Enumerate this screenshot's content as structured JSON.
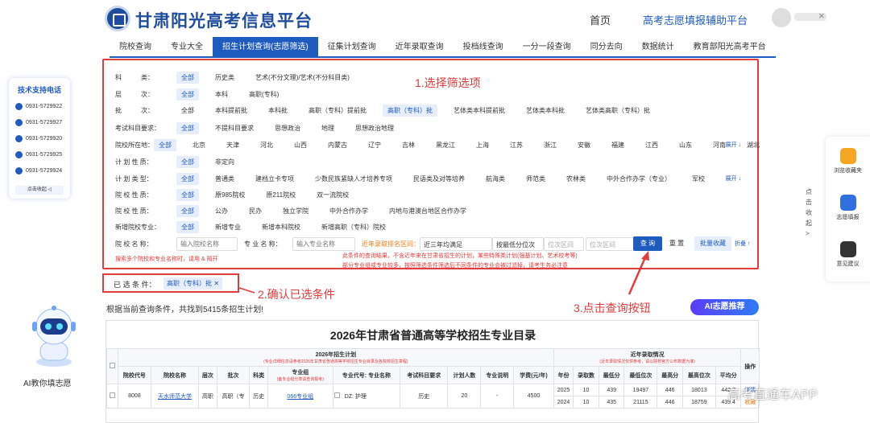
{
  "header": {
    "site_title": "甘肃阳光高考信息平台",
    "nav_home": "首页",
    "nav_fill": "高考志愿填报辅助平台",
    "user_close": "×"
  },
  "tabs": [
    {
      "label": "院校查询"
    },
    {
      "label": "专业大全"
    },
    {
      "label": "招生计划查询(志愿筛选)",
      "active": true
    },
    {
      "label": "征集计划查询"
    },
    {
      "label": "近年录取查询"
    },
    {
      "label": "投档线查询"
    },
    {
      "label": "一分一段查询"
    },
    {
      "label": "同分去向"
    },
    {
      "label": "数据统计"
    },
    {
      "label": "教育部阳光高考平台"
    }
  ],
  "filters": [
    {
      "label": "科　　　类：",
      "options": [
        "全部",
        "历史类",
        "艺术(不分文理)/艺术(不分科目类)"
      ],
      "selected": 0
    },
    {
      "label": "层　　　次：",
      "options": [
        "全部",
        "本科",
        "高职(专科)"
      ],
      "selected": 0
    },
    {
      "label": "批　　　次：",
      "options": [
        "全部",
        "本科提前批",
        "本科批",
        "高职（专科）提前批",
        "高职（专科）批",
        "艺体类本科提前批",
        "艺体类本科批",
        "艺体类高职（专科）批"
      ],
      "selected": 4
    },
    {
      "label": "考试科目要求：",
      "options": [
        "全部",
        "不提科目要求",
        "思想政治",
        "地理",
        "思想政治地理"
      ],
      "selected": 0
    },
    {
      "label": "院校所在地：",
      "options": [
        "全部",
        "北京",
        "天津",
        "河北",
        "山西",
        "内蒙古",
        "辽宁",
        "吉林",
        "黑龙江",
        "上海",
        "江苏",
        "浙江",
        "安徽",
        "福建",
        "江西",
        "山东",
        "河南",
        "湖北"
      ],
      "selected": 0,
      "expand": "展开 ↓"
    },
    {
      "label": "计 划 性 质：",
      "options": [
        "全部",
        "非定向"
      ],
      "selected": 0
    },
    {
      "label": "计 划 类 型：",
      "options": [
        "全部",
        "普通类",
        "建档立卡专项",
        "少数民族紧缺人才培养专项",
        "民语类及对等培养",
        "航海类",
        "师范类",
        "农林类",
        "中外合作办学（专业）",
        "军校"
      ],
      "selected": 0,
      "expand": "展开 ↓"
    },
    {
      "label": "院 校 性 质：",
      "options": [
        "全部",
        "原985院校",
        "原211院校",
        "双一流院校"
      ],
      "selected": 0
    },
    {
      "label": "院 校 性 质：",
      "options": [
        "全部",
        "公办",
        "民办",
        "独立学院",
        "中外合作办学",
        "内地与港澳台地区合作办学"
      ],
      "selected": 0
    },
    {
      "label": "新增院校专业：",
      "options": [
        "全部",
        "新增专业",
        "新增本科院校",
        "新增高职（专科）院校"
      ],
      "selected": 0
    }
  ],
  "search_row": {
    "school_label": "院 校 名 称：",
    "school_placeholder": "输入院校名称",
    "major_label": "专 业 名 称：",
    "major_placeholder": "输入专业名称",
    "rank_label": "近年录取排名区间：",
    "rank_select": "近三年均满足",
    "rank_type": "按最低分位次",
    "rank_from": "位次区间",
    "rank_to": "位次区间",
    "search": "查 询",
    "reset": "重 置",
    "batch": "批量收藏",
    "fold": "折叠 ↑",
    "hint_left": "搜索多个院校和专业名称时，请用 & 隔开",
    "hint_right_1": "此条件的查询结果，不含近年来在甘肃省招生的计划，某些特殊类计划(强基计划、艺术校考等)",
    "hint_right_2": "部分专业组或专业较多，按照筛选条件筛选后不同条件的专业会被过滤掉，请考生务必注意"
  },
  "annotations": {
    "step1": "1.选择筛选项",
    "step2": "2.确认已选条件",
    "step3": "3.点击查询按钮"
  },
  "selected": {
    "label": "已 选 条 件：",
    "tag": "高职（专科）批 ✕"
  },
  "result_count": "根据当前查询条件，共找到5415条招生计划!",
  "ai_button": "AI志愿推荐",
  "table": {
    "title": "2026年甘肃省普通高等学校招生专业目录",
    "plan_header": "2026年招生计划",
    "plan_sub": "(专业详细信息请参考2026年甘肃省普通高等学校招生专业目录及各院校招生章程)",
    "recent_header": "近年录取情况",
    "recent_sub": "(近年录取情况仅供参考，请以院校官方公布数据为准)",
    "action_header": "操作",
    "columns": [
      "院校代号",
      "院校名称",
      "层次",
      "批次",
      "科类",
      "专业组",
      "专业代号: 专业名称",
      "考试科目要求",
      "计划人数",
      "专业说明",
      "学费(元/年)",
      "年份",
      "录取数",
      "最低分",
      "最低位次",
      "最高分",
      "最高位次",
      "平均分"
    ],
    "group_sub": "(备专业组分类请查询报考)",
    "rows": [
      {
        "code": "8008",
        "school": "天水师范大学",
        "level": "高职",
        "batch": "高职（专",
        "cat": "历史",
        "group": "066专业组",
        "major": "DZ: 护理",
        "subject": "历史",
        "count": "20",
        "note": "-",
        "fee": "4500",
        "years": [
          {
            "year": "2025",
            "n": "10",
            "min": "439",
            "minr": "19497",
            "max": "446",
            "maxr": "18013",
            "avg": "442.7",
            "act": "详情"
          },
          {
            "year": "2024",
            "n": "10",
            "min": "435",
            "minr": "21115",
            "max": "446",
            "maxr": "18759",
            "avg": "439.4",
            "act": "收藏"
          }
        ]
      }
    ]
  },
  "left_card": {
    "title": "技术支持电话",
    "phones": [
      "0931-5729922",
      "0931-5729927",
      "0931-5729920",
      "0931-5729925",
      "0931-5729924"
    ],
    "fold": "点击收起 ◁"
  },
  "ai_caption": "AI教你填志愿",
  "right_panel": [
    {
      "label": "浏览收藏夹",
      "color": "#f5a623"
    },
    {
      "label": "志愿填报",
      "color": "#2f6fe0"
    },
    {
      "label": "意见建议",
      "color": "#333333"
    }
  ],
  "side_vertical": "点击收起 >",
  "watermark": "高考直通车APP",
  "accent": "#1e5bbf",
  "annotation_color": "#e23b3b"
}
